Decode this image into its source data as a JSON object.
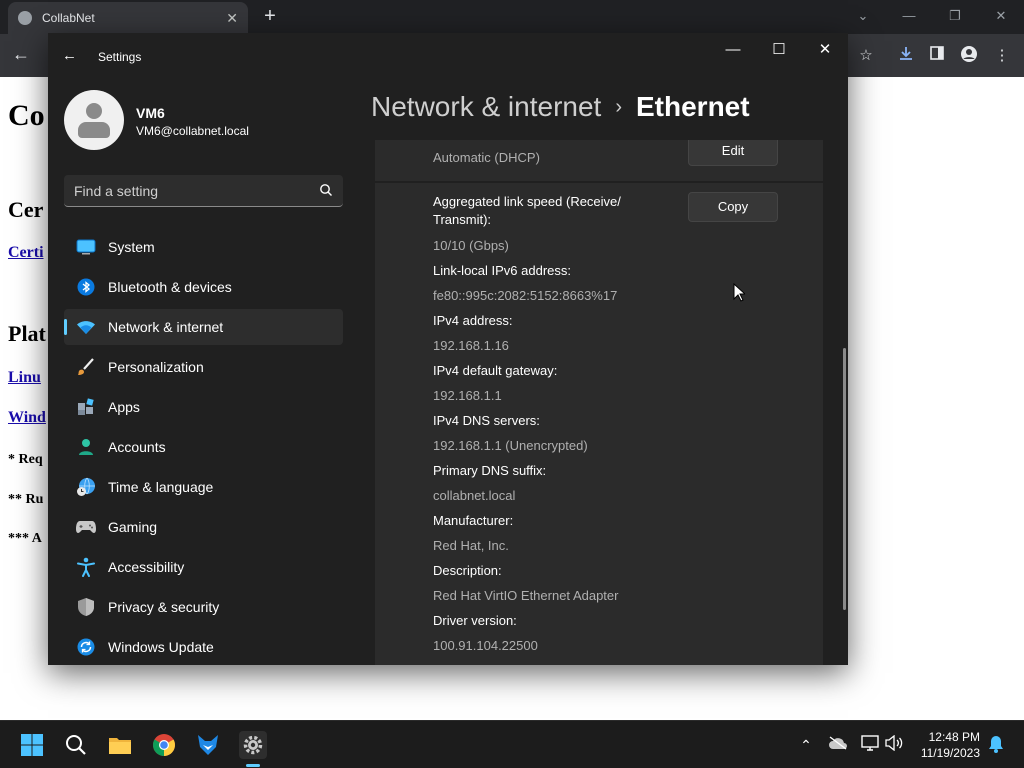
{
  "browser": {
    "tab_title": "CollabNet",
    "page": {
      "heading": "Co",
      "sub1": "Cer",
      "link1": "Certi",
      "sub2": "Plat",
      "link2": "Linu",
      "link3": "Wind",
      "note1": "* Req",
      "note2": "** Ru",
      "note3": "*** A"
    }
  },
  "settings": {
    "window_title": "Settings",
    "user": {
      "name": "VM6",
      "email": "VM6@collabnet.local"
    },
    "search": {
      "placeholder": "Find a setting"
    },
    "nav": [
      {
        "label": "System",
        "icon": "monitor-icon"
      },
      {
        "label": "Bluetooth & devices",
        "icon": "bluetooth-icon"
      },
      {
        "label": "Network & internet",
        "icon": "wifi-icon",
        "selected": true
      },
      {
        "label": "Personalization",
        "icon": "brush-icon"
      },
      {
        "label": "Apps",
        "icon": "apps-icon"
      },
      {
        "label": "Accounts",
        "icon": "person-icon"
      },
      {
        "label": "Time & language",
        "icon": "globe-clock-icon"
      },
      {
        "label": "Gaming",
        "icon": "gamepad-icon"
      },
      {
        "label": "Accessibility",
        "icon": "accessibility-icon"
      },
      {
        "label": "Privacy & security",
        "icon": "shield-icon"
      },
      {
        "label": "Windows Update",
        "icon": "update-icon"
      }
    ],
    "breadcrumb": {
      "parent": "Network & internet",
      "separator": "›",
      "current": "Ethernet"
    },
    "edit_button": "Edit",
    "copy_button": "Copy",
    "dns_assignment_value": "Automatic (DHCP)",
    "properties": [
      {
        "label": "Aggregated link speed (Receive/ Transmit):",
        "value": "10/10 (Gbps)"
      },
      {
        "label": "Link-local IPv6 address:",
        "value": "fe80::995c:2082:5152:8663%17"
      },
      {
        "label": "IPv4 address:",
        "value": "192.168.1.16"
      },
      {
        "label": "IPv4 default gateway:",
        "value": "192.168.1.1"
      },
      {
        "label": "IPv4 DNS servers:",
        "value": "192.168.1.1 (Unencrypted)"
      },
      {
        "label": "Primary DNS suffix:",
        "value": "collabnet.local"
      },
      {
        "label": "Manufacturer:",
        "value": "Red Hat, Inc."
      },
      {
        "label": "Description:",
        "value": "Red Hat VirtIO Ethernet Adapter"
      },
      {
        "label": "Driver version:",
        "value": "100.91.104.22500"
      }
    ]
  },
  "taskbar": {
    "time": "12:48 PM",
    "date": "11/19/2023"
  },
  "colors": {
    "accent": "#60cdff",
    "window_bg": "#202020",
    "card_bg": "#2b2b2b"
  }
}
